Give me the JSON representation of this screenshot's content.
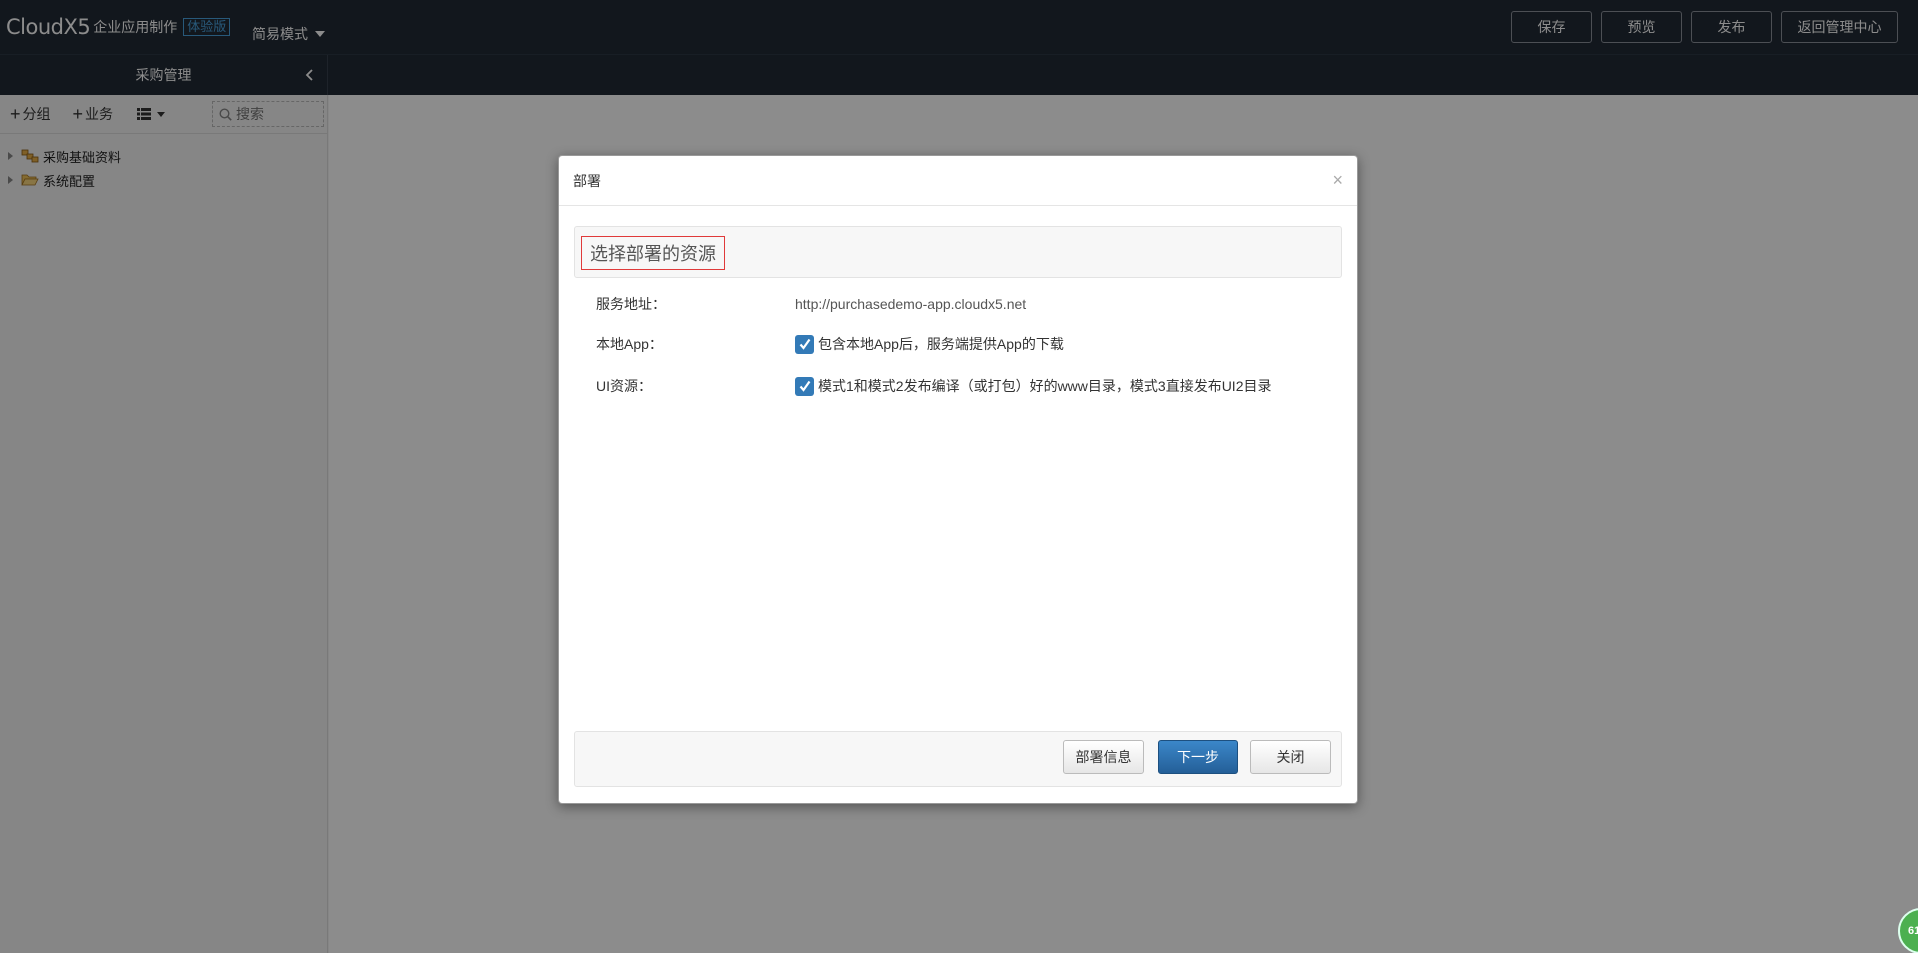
{
  "app": {
    "logo_text": "CloudX5",
    "logo_subtitle": "企业应用制作",
    "edition_badge": "体验版",
    "mode_label": "简易模式"
  },
  "top_actions": [
    "保存",
    "预览",
    "发布",
    "返回管理中心"
  ],
  "sidebar": {
    "title": "采购管理",
    "toolbar": {
      "add_group": "分组",
      "add_business": "业务",
      "search_placeholder": "搜索"
    },
    "tree": [
      {
        "label": "采购基础资料",
        "icon": "modules-icon"
      },
      {
        "label": "系统配置",
        "icon": "folder-open-icon"
      }
    ]
  },
  "dialog": {
    "title": "部署",
    "close": "×",
    "section_title": "选择部署的资源",
    "rows": [
      {
        "label": "服务地址：",
        "value": "http://purchasedemo-app.cloudx5.net"
      },
      {
        "label": "本地App：",
        "value": "包含本地App后，服务端提供App的下载",
        "checked": true
      },
      {
        "label": "UI资源：",
        "value": "模式1和模式2发布编译（或打包）好的www目录，模式3直接发布UI2目录",
        "checked": true
      }
    ],
    "buttons": {
      "info": "部署信息",
      "next": "下一步",
      "close": "关闭"
    }
  },
  "corner_badge": "61",
  "colors": {
    "topbar": "#222a35",
    "primary": "#337ab7",
    "highlight_border": "#e03a3a",
    "badge_blue": "#4aa3df"
  }
}
